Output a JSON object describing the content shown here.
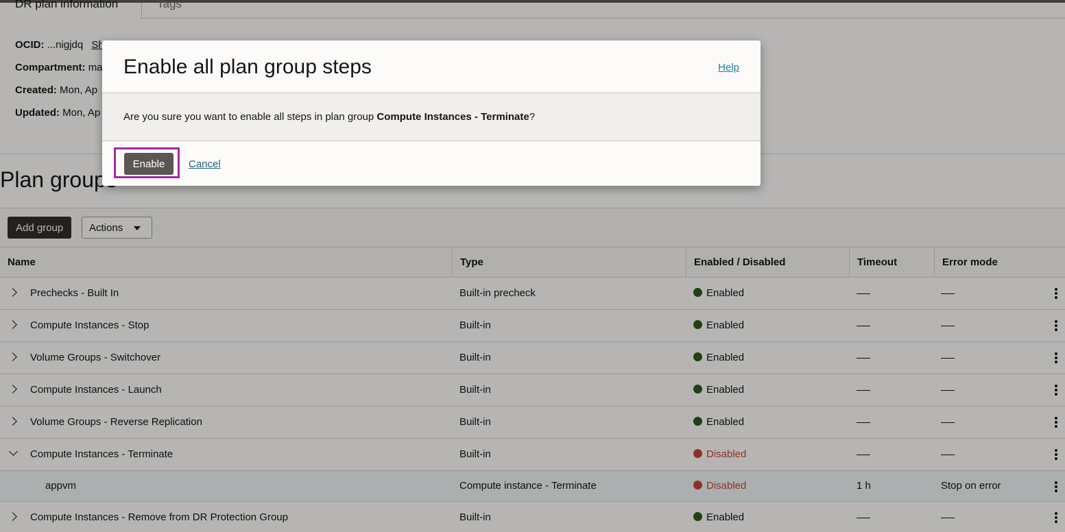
{
  "tabs": [
    {
      "label": "DR plan information"
    },
    {
      "label": "Tags"
    }
  ],
  "info": {
    "ocid_label": "OCID:",
    "ocid_value": "...nigjdq",
    "ocid_link": "Sh",
    "compartment_label": "Compartment:",
    "compartment_value": "ma",
    "created_label": "Created:",
    "created_value": "Mon, Ap",
    "updated_label": "Updated:",
    "updated_value": "Mon, Ap"
  },
  "section_title": "Plan groups",
  "toolbar": {
    "add_group": "Add group",
    "actions": "Actions"
  },
  "table": {
    "headers": [
      "Name",
      "Type",
      "Enabled / Disabled",
      "Timeout",
      "Error mode"
    ],
    "rows": [
      {
        "name": "Prechecks - Built In",
        "type": "Built-in precheck",
        "status": "Enabled",
        "timeout": "",
        "error_mode": ""
      },
      {
        "name": "Compute Instances - Stop",
        "type": "Built-in",
        "status": "Enabled",
        "timeout": "",
        "error_mode": ""
      },
      {
        "name": "Volume Groups - Switchover",
        "type": "Built-in",
        "status": "Enabled",
        "timeout": "",
        "error_mode": ""
      },
      {
        "name": "Compute Instances - Launch",
        "type": "Built-in",
        "status": "Enabled",
        "timeout": "",
        "error_mode": ""
      },
      {
        "name": "Volume Groups - Reverse Replication",
        "type": "Built-in",
        "status": "Enabled",
        "timeout": "",
        "error_mode": ""
      },
      {
        "name": "Compute Instances - Terminate",
        "type": "Built-in",
        "status": "Disabled",
        "timeout": "",
        "error_mode": ""
      },
      {
        "name": "appvm",
        "type": "Compute instance - Terminate",
        "status": "Disabled",
        "timeout": "1 h",
        "error_mode": "Stop on error"
      },
      {
        "name": "Compute Instances - Remove from DR Protection Group",
        "type": "Built-in",
        "status": "Enabled",
        "timeout": "",
        "error_mode": ""
      }
    ]
  },
  "dialog": {
    "title": "Enable all plan group steps",
    "help": "Help",
    "message_prefix": "Are you sure you want to enable all steps in plan group ",
    "message_group": "Compute Instances - Terminate",
    "message_suffix": "?",
    "enable_label": "Enable",
    "cancel_label": "Cancel"
  },
  "colors": {
    "enabled": "#2d5a1a",
    "disabled": "#c74634",
    "focus": "#9e2ba3",
    "link": "#227e9e"
  },
  "icons": {
    "row_collapsed": "chevron-right-icon",
    "row_expanded": "chevron-down-icon",
    "row_menu": "kebab-menu-icon",
    "status": "status-dot-icon",
    "dropdown": "caret-down-icon"
  }
}
